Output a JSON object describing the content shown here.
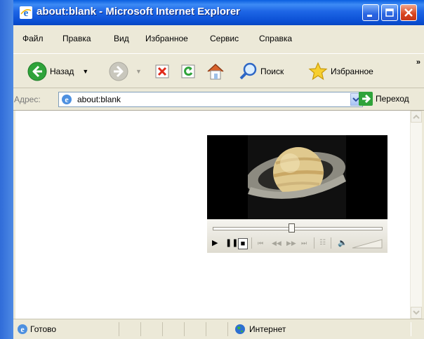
{
  "window": {
    "title": "about:blank - Microsoft Internet Explorer",
    "accent": "#0a5fe0",
    "title_icon": "ie-icon"
  },
  "menu": [
    "Файл",
    "Правка",
    "Вид",
    "Избранное",
    "Сервис",
    "Справка"
  ],
  "toolbar": {
    "back_label": "Назад",
    "search_label": "Поиск",
    "favorites_label": "Избранное",
    "more": "»"
  },
  "address": {
    "label": "Адрес:",
    "value": "about:blank",
    "go_label": "Переход"
  },
  "status": {
    "text": "Готово",
    "zone": "Интернет"
  },
  "player": {
    "seek_position": 0.47,
    "icons": [
      "play-icon",
      "pause-icon",
      "stop-icon",
      "previous-icon",
      "rewind-icon",
      "fast-forward-icon",
      "next-icon",
      "playlist-icon",
      "volume-icon"
    ]
  }
}
